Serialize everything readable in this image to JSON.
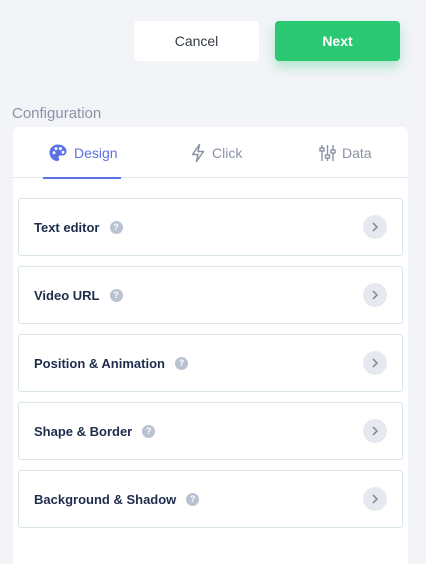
{
  "header": {
    "cancel_label": "Cancel",
    "next_label": "Next"
  },
  "section_title": "Configuration",
  "tabs": [
    {
      "label": "Design",
      "icon": "palette-icon",
      "active": true
    },
    {
      "label": "Click",
      "icon": "lightning-icon",
      "active": false
    },
    {
      "label": "Data",
      "icon": "sliders-icon",
      "active": false
    }
  ],
  "accordion": [
    {
      "label": "Text editor",
      "help_icon": "question-icon"
    },
    {
      "label": "Video URL",
      "help_icon": "question-icon"
    },
    {
      "label": "Position & Animation",
      "help_icon": "question-icon"
    },
    {
      "label": "Shape & Border",
      "help_icon": "question-icon"
    },
    {
      "label": "Background & Shadow",
      "help_icon": "question-icon"
    }
  ],
  "colors": {
    "accent": "#5b72e6",
    "primary_button": "#2bc873",
    "background": "#f3f4f8"
  }
}
